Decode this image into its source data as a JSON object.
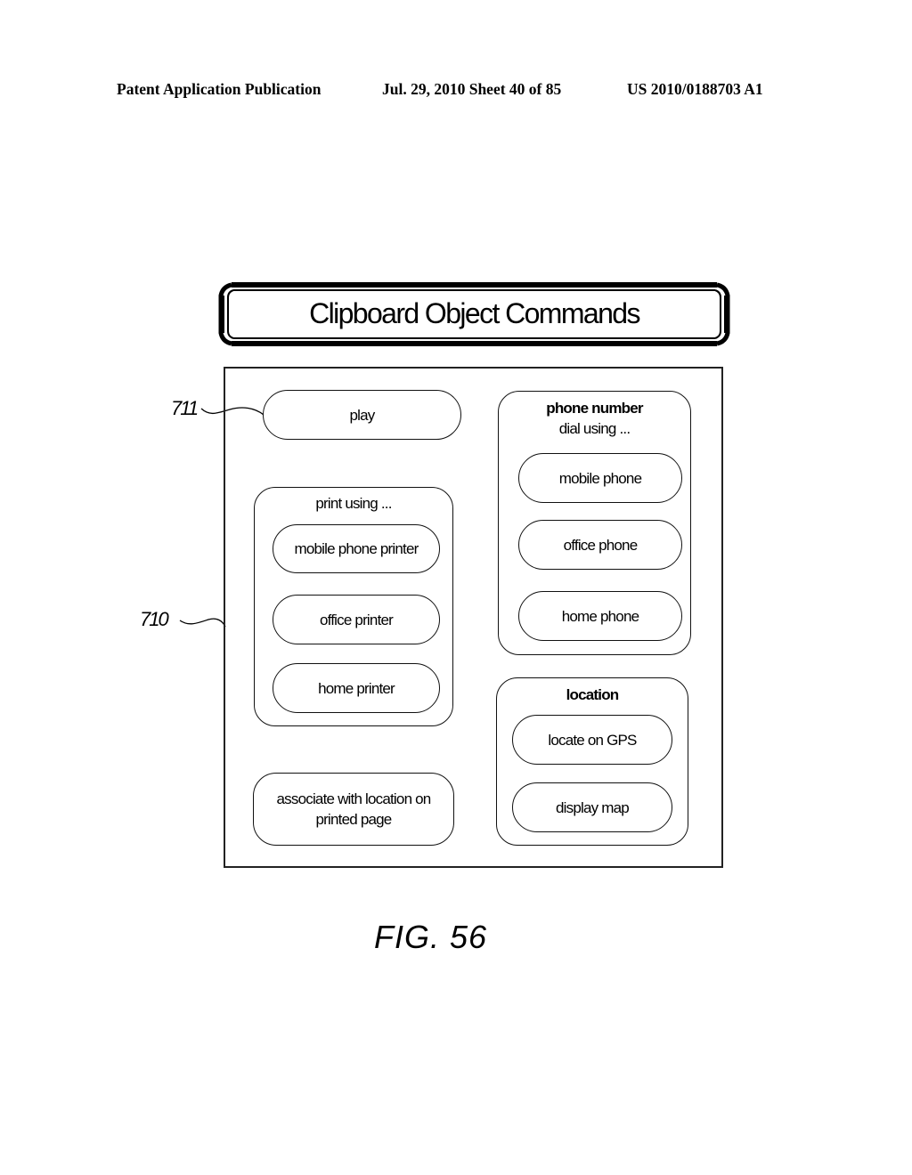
{
  "header": {
    "left": "Patent Application Publication",
    "middle": "Jul. 29, 2010   Sheet 40 of 85",
    "right": "US 2010/0188703 A1"
  },
  "banner": {
    "title": "Clipboard Object Commands"
  },
  "references": {
    "frame": "710",
    "play_button": "711"
  },
  "commands": {
    "play": "play",
    "print_group": {
      "label": "print using ...",
      "items": [
        "mobile phone printer",
        "office printer",
        "home printer"
      ]
    },
    "associate": "associate with location on printed page",
    "phone_group": {
      "title": "phone number",
      "label": "dial using ...",
      "items": [
        "mobile phone",
        "office phone",
        "home phone"
      ]
    },
    "location_group": {
      "title": "location",
      "items": [
        "locate on GPS",
        "display map"
      ]
    }
  },
  "figure_caption": "FIG. 56"
}
